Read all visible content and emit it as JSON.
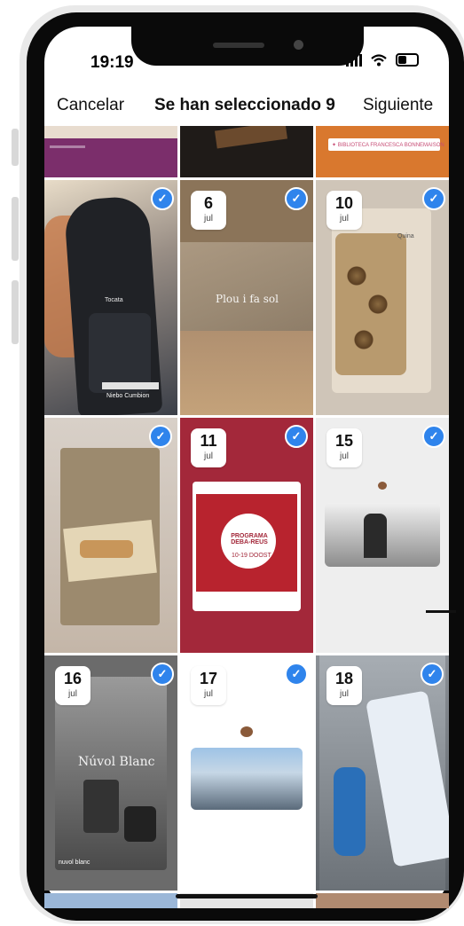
{
  "status_bar": {
    "time": "19:19"
  },
  "header": {
    "cancel_label": "Cancelar",
    "title": "Se han seleccionado 9",
    "next_label": "Siguiente"
  },
  "top_row": {
    "tile3_caption": "✦ BIBLIOTECA FRANCESCA BONNEMAISON"
  },
  "tiles": [
    {
      "day": "",
      "month": "",
      "selected": true,
      "caption": "Tocata",
      "sub": "Niebo Cumbion"
    },
    {
      "day": "6",
      "month": "jul",
      "selected": true,
      "caption": "Plou i fa sol"
    },
    {
      "day": "10",
      "month": "jul",
      "selected": true,
      "caption": "Quina"
    },
    {
      "day": "",
      "month": "",
      "selected": true,
      "caption": ""
    },
    {
      "day": "11",
      "month": "jul",
      "selected": true,
      "caption": "PROGRAMA DEBA-REUS",
      "sub": "10-19 DOOST"
    },
    {
      "day": "15",
      "month": "jul",
      "selected": true,
      "caption": ""
    },
    {
      "day": "16",
      "month": "jul",
      "selected": true,
      "caption": "Núvol Blanc",
      "sub": "nuvol blanc"
    },
    {
      "day": "17",
      "month": "jul",
      "selected": true,
      "caption": ""
    },
    {
      "day": "18",
      "month": "jul",
      "selected": true,
      "caption": ""
    }
  ],
  "icons": {
    "check": "checkmark-icon",
    "wifi": "wifi-icon",
    "battery": "battery-icon",
    "signal": "signal-icon"
  },
  "colors": {
    "accent": "#2f84ec",
    "tile_red": "#a3283a",
    "tile_purple": "#7a2d6a"
  }
}
